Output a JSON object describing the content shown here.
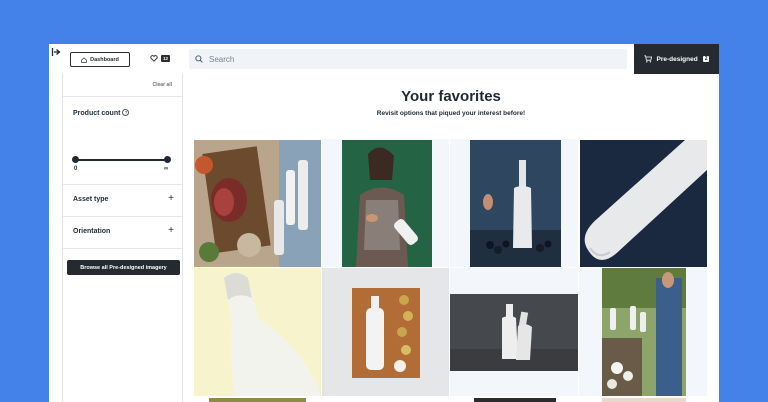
{
  "header": {
    "dashboard_label": "Dashboard",
    "favorites_count": "12",
    "search_placeholder": "Search",
    "predesigned_label": "Pre-designed",
    "predesigned_count": "2"
  },
  "sidebar": {
    "clear_all": "Clear all",
    "product_count_label": "Product count",
    "slider_min": "0",
    "slider_max": "∞",
    "asset_type_label": "Asset type",
    "orientation_label": "Orientation",
    "browse_button": "Browse all Pre-designed imagery"
  },
  "main": {
    "title": "Your favorites",
    "subtitle": "Revisit options that piqued your interest before!"
  },
  "colors": {
    "background": "#4481e8",
    "dark": "#252a30",
    "search_bg": "#f0f4f9"
  },
  "icons": [
    "sidebar-collapse-icon",
    "home-icon",
    "heart-icon",
    "search-icon",
    "cart-icon",
    "help-icon",
    "plus-icon"
  ]
}
